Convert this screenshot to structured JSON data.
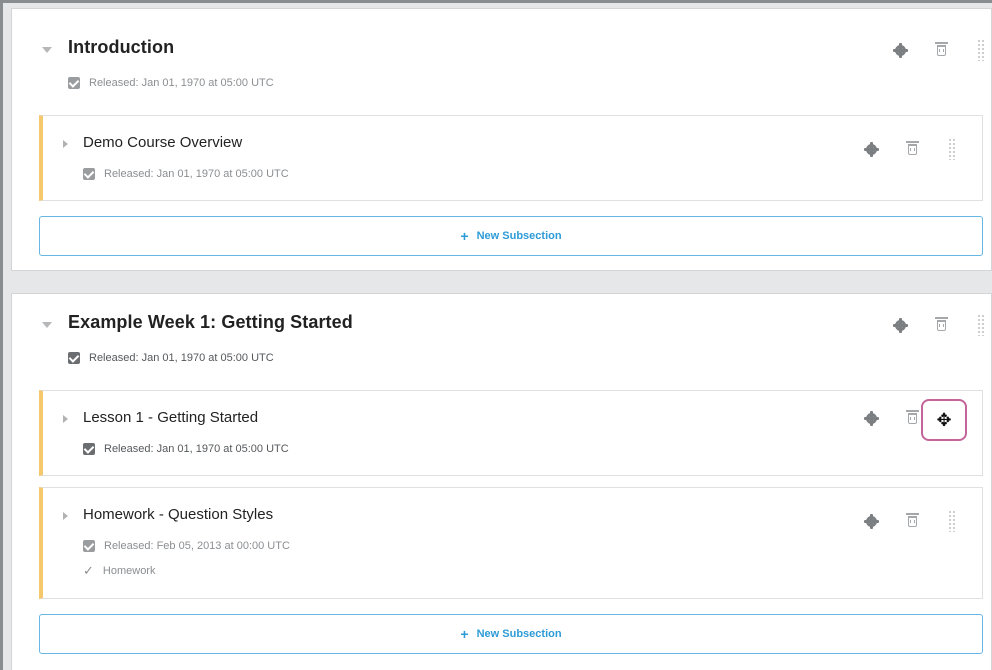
{
  "sections": [
    {
      "title": "Introduction",
      "released": "Released: Jan 01, 1970 at 05:00 UTC",
      "subsections": [
        {
          "title": "Demo Course Overview",
          "released": "Released: Jan 01, 1970 at 05:00 UTC"
        }
      ],
      "new_subsection_label": "New Subsection"
    },
    {
      "title": "Example Week 1: Getting Started",
      "released": "Released: Jan 01, 1970 at 05:00 UTC",
      "subsections": [
        {
          "title": "Lesson 1 - Getting Started",
          "released": "Released: Jan 01, 1970 at 05:00 UTC"
        },
        {
          "title": "Homework - Question Styles",
          "released": "Released: Feb 05, 2013 at 00:00 UTC",
          "grading": "Homework"
        }
      ],
      "new_subsection_label": "New Subsection"
    }
  ],
  "icons": {
    "plus": "+",
    "move": "✥",
    "tick": "✓"
  },
  "colors": {
    "accent_blue": "#2d9bd6",
    "subsection_border": "#f6c86e",
    "move_highlight": "#c26598"
  }
}
